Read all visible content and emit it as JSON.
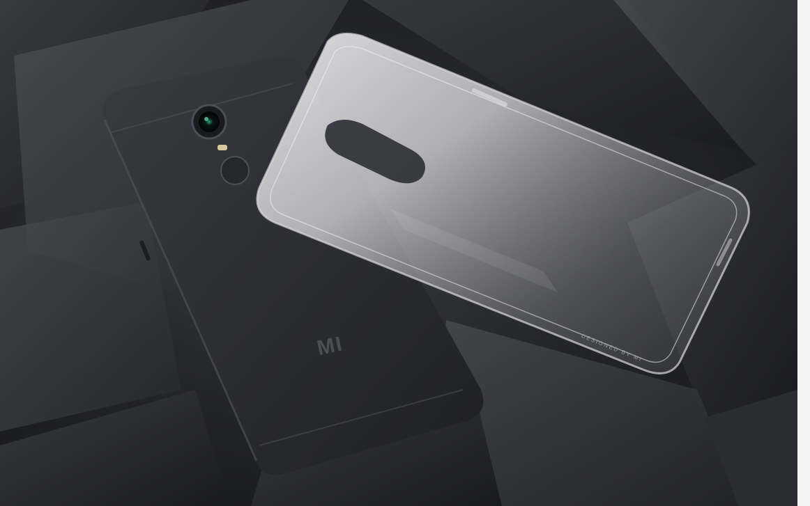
{
  "scene": {
    "description_alt": "",
    "phone": {
      "logo": "MI",
      "regulatory_lines": [
        "",
        ""
      ],
      "color": "#2c2d33",
      "camera_accent": "#1fa37a"
    },
    "case": {
      "printed_text": "DESIGNED BY MI"
    },
    "background_color": "#1b1c21"
  }
}
